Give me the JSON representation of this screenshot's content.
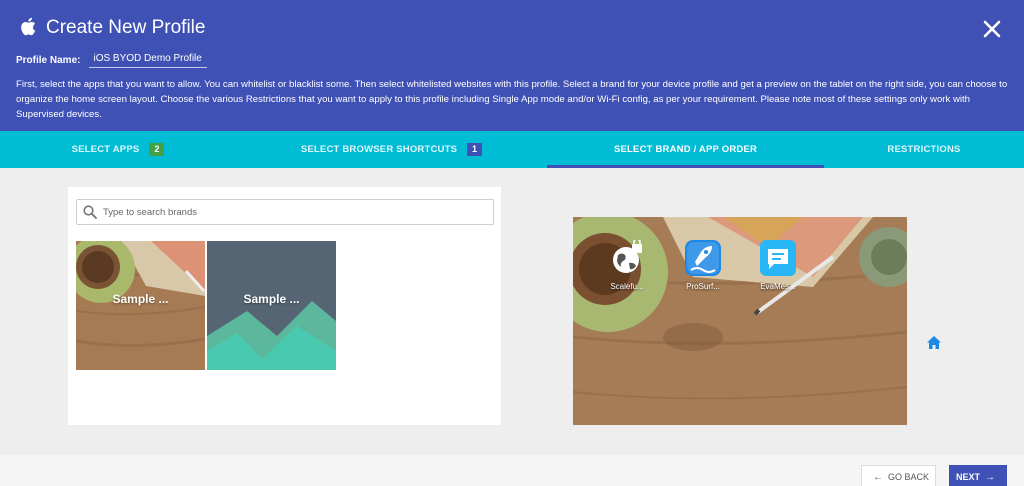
{
  "header": {
    "title": "Create New Profile",
    "close_icon": "close-icon",
    "profile_name_label": "Profile Name:",
    "profile_name_value": "iOS BYOD Demo Profile",
    "description": "First, select the apps that you want to allow. You can whitelist or blacklist some. Then select whitelisted websites with this profile. Select a brand for your device profile and get a preview on the tablet on the right side, you can choose to organize the home screen layout. Choose the various Restrictions that you want to apply to this profile including Single App mode and/or Wi-Fi config, as per your requirement. Please note most of these settings only work with Supervised devices."
  },
  "tabs": [
    {
      "label": "SELECT APPS",
      "badge": "2",
      "badge_color": "#43a047"
    },
    {
      "label": "SELECT BROWSER SHORTCUTS",
      "badge": "1",
      "badge_color": "#3f51b5"
    },
    {
      "label": "SELECT BRAND / APP ORDER",
      "active": true
    },
    {
      "label": "RESTRICTIONS"
    }
  ],
  "brand_search": {
    "placeholder": "Type to search brands"
  },
  "brands": [
    {
      "label": "Sample ...",
      "selected": true
    },
    {
      "label": "Sample ...",
      "selected": false
    }
  ],
  "preview": {
    "apps": [
      {
        "label": "Scalefu...",
        "icon": "globe-lock-icon"
      },
      {
        "label": "ProSurf...",
        "icon": "rocket-icon"
      },
      {
        "label": "EvaMes...",
        "icon": "chat-icon"
      }
    ],
    "home_icon": "home-icon"
  },
  "footer": {
    "back_label": "GO BACK",
    "next_label": "NEXT"
  },
  "colors": {
    "header": "#3f51b5",
    "tabs": "#00bcd4",
    "accent": "#3f51b5",
    "selected_border": "#2196f3"
  }
}
